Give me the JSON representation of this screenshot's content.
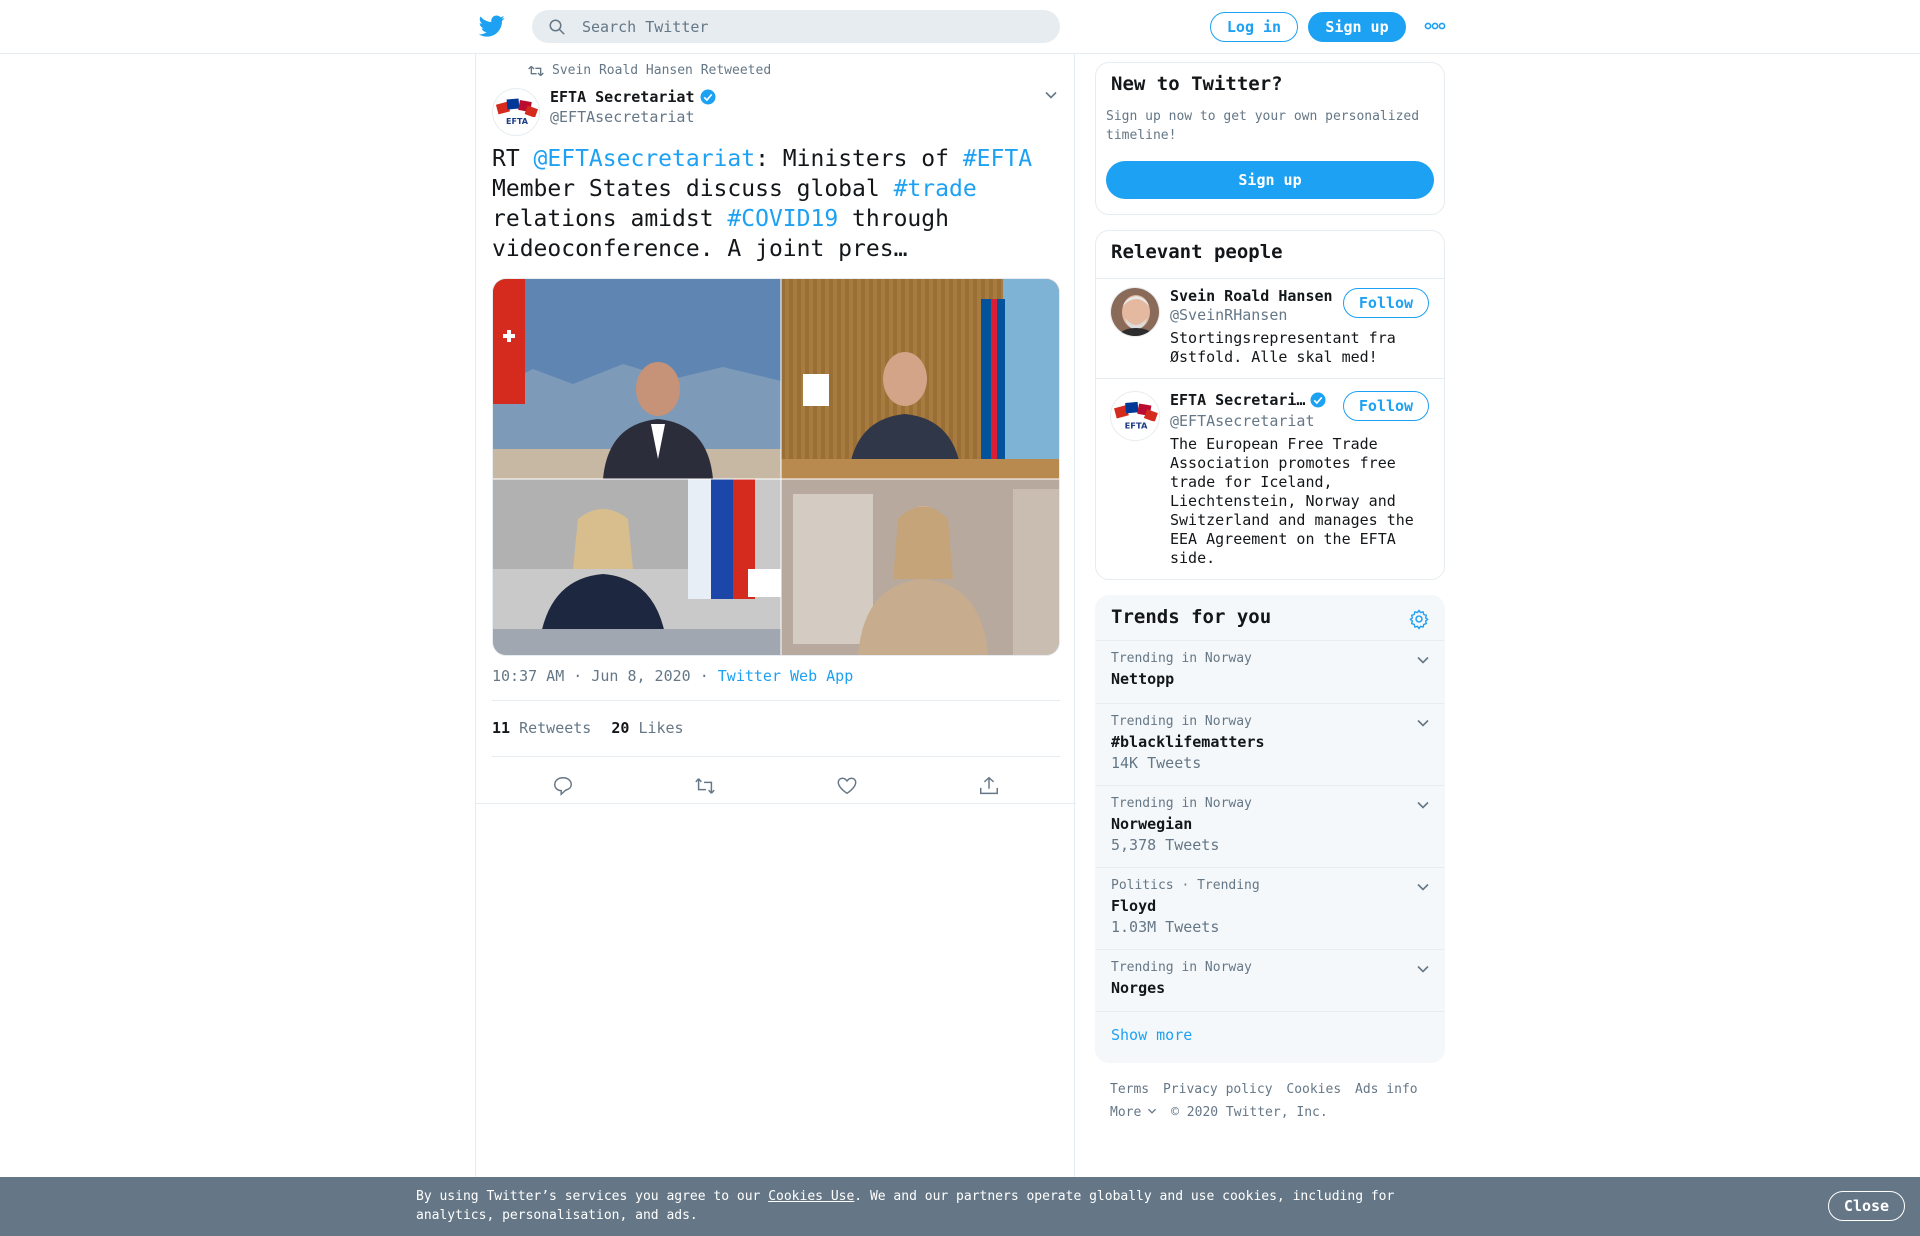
{
  "header": {
    "logo_icon": "twitter-bird-icon",
    "search_placeholder": "Search Twitter",
    "login_label": "Log in",
    "signup_label": "Sign up",
    "more_icon": "more-dots-icon",
    "accent_color": "#1da1f2"
  },
  "tweet": {
    "retweeted_by": "Svein Roald Hansen Retweeted",
    "author_name": "EFTA Secretariat",
    "author_handle": "@EFTAsecretariat",
    "text_parts": {
      "rt": "RT ",
      "mention": "@EFTAsecretariat",
      "t1": ": Ministers of ",
      "tag1": "#EFTA",
      "t2": " Member States discuss global ",
      "tag2": "#trade",
      "t3": " relations amidst ",
      "tag3": "#COVID19",
      "t4": " through videoconference. A joint pres…"
    },
    "timestamp": "10:37 AM · Jun 8, 2020",
    "separator": "·",
    "source_app": "Twitter Web App",
    "retweet_count": "11",
    "retweet_label": "Retweets",
    "like_count": "20",
    "like_label": "Likes"
  },
  "sidebar": {
    "new_to_twitter": {
      "title": "New to Twitter?",
      "description": "Sign up now to get your own personalized timeline!",
      "button_label": "Sign up"
    },
    "relevant_people": {
      "title": "Relevant people",
      "people": [
        {
          "name": "Svein Roald Hansen",
          "handle": "@SveinRHansen",
          "bio": "Stortingsrepresentant fra Østfold. Alle skal med!",
          "follow_label": "Follow"
        },
        {
          "name": "EFTA Secretari…",
          "handle": "@EFTAsecretariat",
          "bio": "The European Free Trade Association promotes free trade for Iceland, Liechtenstein, Norway and Switzerland and manages the EEA Agreement on the EFTA side.",
          "follow_label": "Follow"
        }
      ]
    },
    "trends": {
      "title": "Trends for you",
      "items": [
        {
          "context": "Trending in Norway",
          "name": "Nettopp",
          "count": ""
        },
        {
          "context": "Trending in Norway",
          "name": "#blacklifematters",
          "count": "14K Tweets"
        },
        {
          "context": "Trending in Norway",
          "name": "Norwegian",
          "count": "5,378 Tweets"
        },
        {
          "context": "Politics · Trending",
          "name": "Floyd",
          "count": "1.03M Tweets"
        },
        {
          "context": "Trending in Norway",
          "name": "Norges",
          "count": ""
        }
      ],
      "show_more": "Show more"
    },
    "footer": {
      "terms": "Terms",
      "privacy": "Privacy policy",
      "cookies": "Cookies",
      "ads": "Ads info",
      "more": "More",
      "copyright": "© 2020 Twitter, Inc."
    }
  },
  "cookie_bar": {
    "text_before": "By using Twitter’s services you agree to our ",
    "link": "Cookies Use",
    "text_after": ". We and our partners operate globally and use cookies, including for analytics, personalisation, and ads.",
    "close_label": "Close"
  }
}
